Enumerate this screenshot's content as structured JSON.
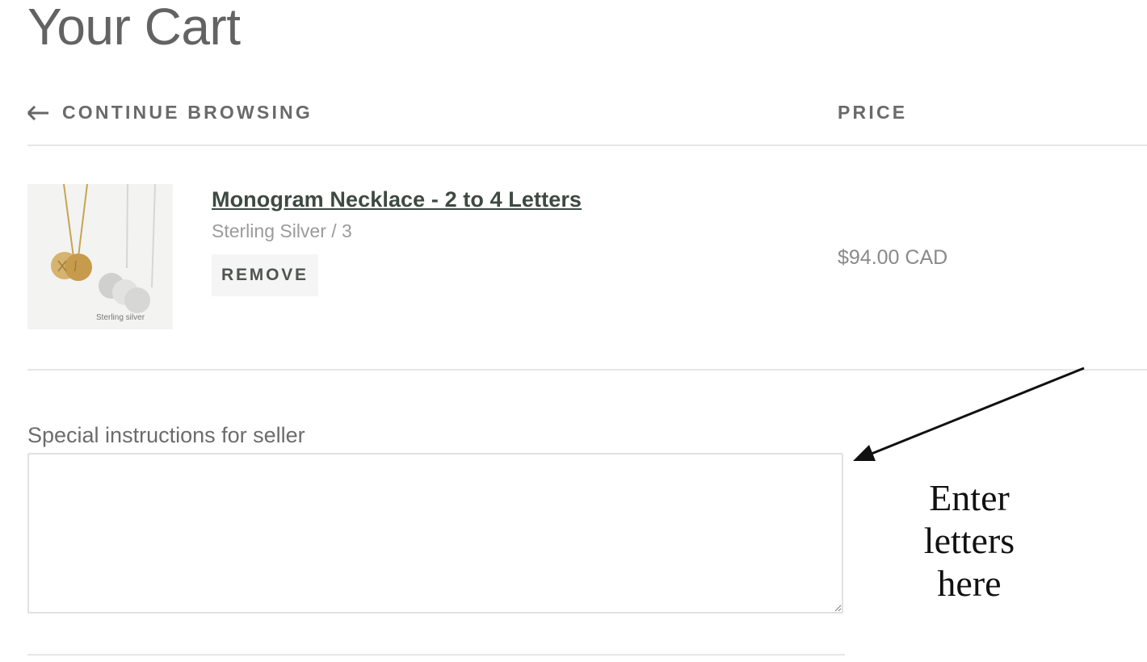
{
  "page": {
    "title": "Your Cart"
  },
  "header": {
    "continue_label": "CONTINUE BROWSING",
    "price_label": "PRICE",
    "arrow_icon": "arrow-left-icon"
  },
  "cart": {
    "items": [
      {
        "name": "Monogram Necklace - 2 to 4 Letters",
        "variant": "Sterling Silver / 3",
        "remove_label": "REMOVE",
        "price": "$94.00 CAD",
        "image_caption": "Sterling silver"
      }
    ]
  },
  "instructions": {
    "label": "Special instructions for seller",
    "value": ""
  },
  "annotation": {
    "lines": [
      "Enter",
      "letters",
      "here"
    ],
    "arrow_icon": "annotation-arrow-icon"
  },
  "colors": {
    "title": "#636363",
    "product_name": "#3e4942",
    "muted_text": "#9b9b9b",
    "remove_background": "#f4f5f4",
    "divider": "#e6e6e6",
    "annotation": "#111111"
  }
}
